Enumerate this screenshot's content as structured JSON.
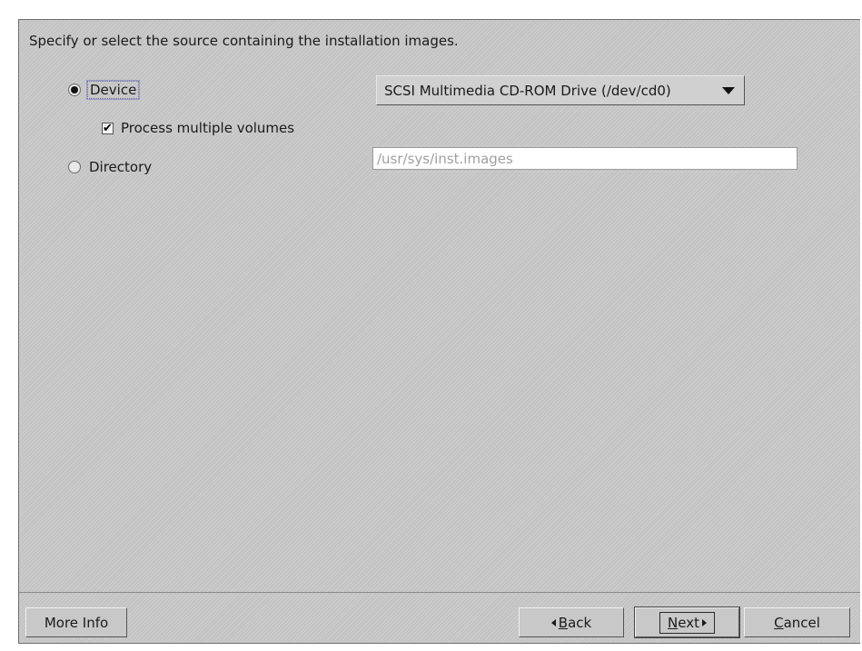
{
  "dialog": {
    "instruction": "Specify or select the source containing the installation images."
  },
  "source": {
    "device": {
      "label": "Device",
      "selected": true
    },
    "process_multiple": {
      "label": "Process multiple volumes",
      "checked": true,
      "check_glyph": "✔"
    },
    "directory": {
      "label": "Directory",
      "selected": false,
      "path_value": "/usr/sys/inst.images"
    },
    "device_select": {
      "value": "SCSI Multimedia CD-ROM Drive (/dev/cd0)",
      "arrow_icon": "triangle-down-icon"
    }
  },
  "buttons": {
    "more_info": "More Info",
    "back_mnemonic": "B",
    "back_rest": "ack",
    "next_mnemonic": "N",
    "next_rest": "ext",
    "cancel_mnemonic": "C",
    "cancel_rest": "ancel"
  },
  "colors": {
    "panel_bg": "#c3c3c3",
    "input_bg": "#ffffff",
    "disabled_text": "#a0a0a0"
  }
}
